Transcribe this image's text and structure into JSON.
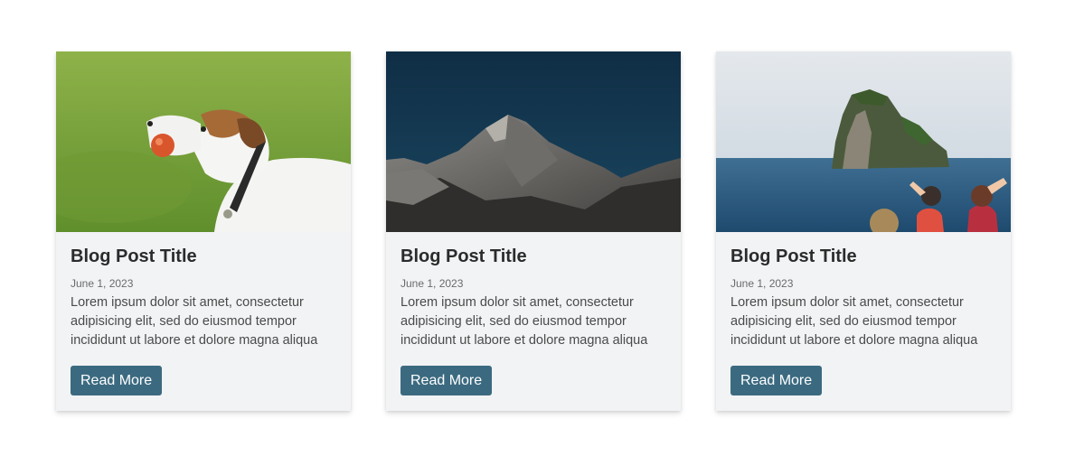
{
  "posts": [
    {
      "image_subject": "dog-with-ball",
      "title": "Blog Post Title",
      "date": "June 1, 2023",
      "excerpt": "Lorem ipsum dolor sit amet, consectetur adipisicing elit, sed do eiusmod tempor incididunt ut labore et dolore magna aliqua",
      "button_label": "Read More"
    },
    {
      "image_subject": "mountain-peak",
      "title": "Blog Post Title",
      "date": "June 1, 2023",
      "excerpt": "Lorem ipsum dolor sit amet, consectetur adipisicing elit, sed do eiusmod tempor incididunt ut labore et dolore magna aliqua",
      "button_label": "Read More"
    },
    {
      "image_subject": "sea-rock-island",
      "title": "Blog Post Title",
      "date": "June 1, 2023",
      "excerpt": "Lorem ipsum dolor sit amet, consectetur adipisicing elit, sed do eiusmod tempor incididunt ut labore et dolore magna aliqua",
      "button_label": "Read More"
    }
  ],
  "colors": {
    "button": "#3b6a80",
    "card_background": "#f1f3f5",
    "title_text": "#2b2b2b"
  }
}
